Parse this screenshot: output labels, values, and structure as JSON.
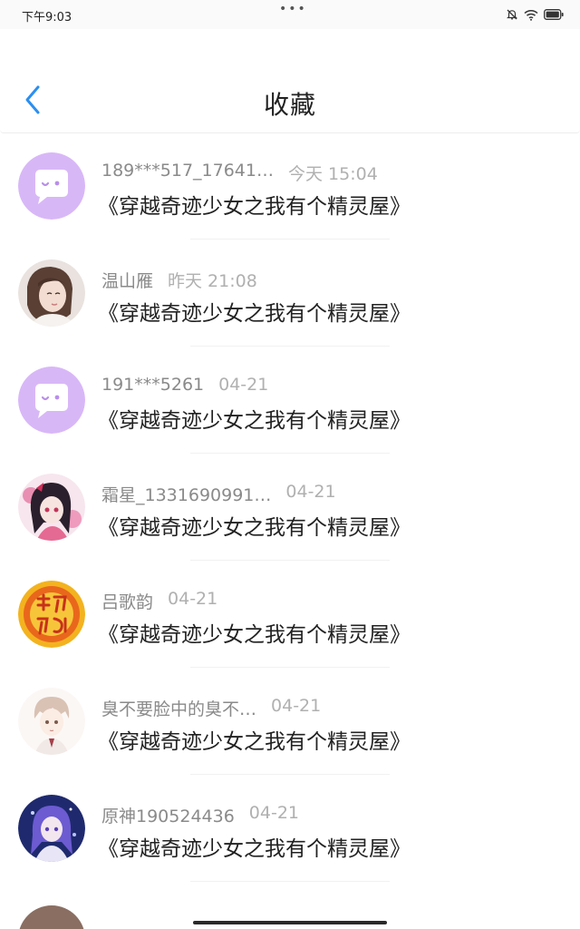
{
  "status_bar": {
    "time": "下午9:03",
    "dots": "•••",
    "icons": [
      "bell-off-icon",
      "wifi-icon",
      "battery-icon"
    ]
  },
  "header": {
    "title": "收藏",
    "back_icon": "chevron-left-icon"
  },
  "colors": {
    "accent": "#2b8ff0",
    "title": "#222222",
    "secondary": "#8a8a8a",
    "chat_avatar": "#d9b8f6"
  },
  "items": [
    {
      "name": "189***517_17641…",
      "time": "今天 15:04",
      "book": "《穿越奇迹少女之我有个精灵屋》",
      "avatar": "chat-bubble-avatar"
    },
    {
      "name": "温山雁",
      "time": "昨天 21:08",
      "book": "《穿越奇迹少女之我有个精灵屋》",
      "avatar": "user-photo-avatar"
    },
    {
      "name": "191***5261",
      "time": "04-21",
      "book": "《穿越奇迹少女之我有个精灵屋》",
      "avatar": "chat-bubble-avatar"
    },
    {
      "name": "霜星_1331690991…",
      "time": "04-21",
      "book": "《穿越奇迹少女之我有个精灵屋》",
      "avatar": "anime-girl-avatar"
    },
    {
      "name": "吕歌韵",
      "time": "04-21",
      "book": "《穿越奇迹少女之我有个精灵屋》",
      "avatar": "new-year-avatar"
    },
    {
      "name": "臭不要脸中的臭不…",
      "time": "04-21",
      "book": "《穿越奇迹少女之我有个精灵屋》",
      "avatar": "anime-boy-avatar"
    },
    {
      "name": "原神190524436",
      "time": "04-21",
      "book": "《穿越奇迹少女之我有个精灵屋》",
      "avatar": "anime-purple-avatar"
    }
  ]
}
